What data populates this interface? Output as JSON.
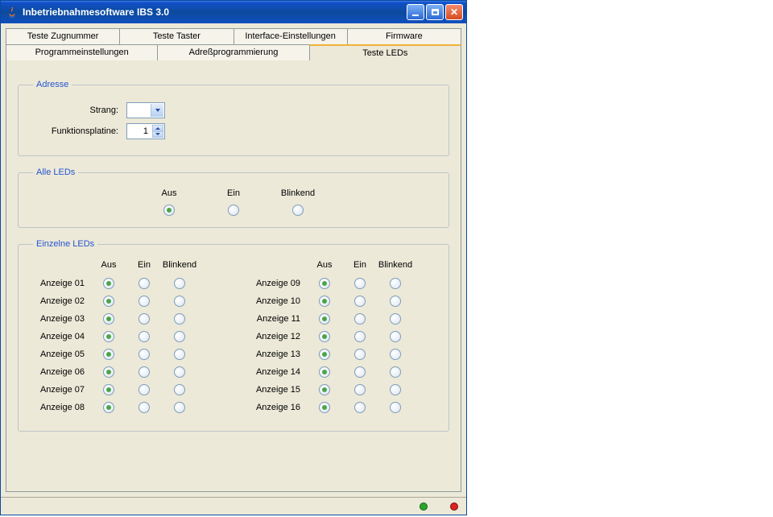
{
  "window": {
    "title": "Inbetriebnahmesoftware IBS 3.0"
  },
  "tabs_row1": [
    {
      "label": "Teste Zugnummer"
    },
    {
      "label": "Teste Taster"
    },
    {
      "label": "Interface-Einstellungen"
    },
    {
      "label": "Firmware"
    }
  ],
  "tabs_row2": [
    {
      "label": "Programmeinstellungen"
    },
    {
      "label": "Adreßprogrammierung"
    },
    {
      "label": "Teste LEDs"
    }
  ],
  "active_tab": "Teste LEDs",
  "groups": {
    "adresse": {
      "title": "Adresse",
      "strang_label": "Strang:",
      "strang_value": "",
      "funktionsplatine_label": "Funktionsplatine:",
      "funktionsplatine_value": "1"
    },
    "alle": {
      "title": "Alle LEDs",
      "headers": [
        "Aus",
        "Ein",
        "Blinkend"
      ],
      "selected": 0
    },
    "einzelne": {
      "title": "Einzelne LEDs",
      "headers": [
        "Aus",
        "Ein",
        "Blinkend"
      ],
      "left": [
        {
          "label": "Anzeige 01",
          "sel": 0
        },
        {
          "label": "Anzeige 02",
          "sel": 0
        },
        {
          "label": "Anzeige 03",
          "sel": 0
        },
        {
          "label": "Anzeige 04",
          "sel": 0
        },
        {
          "label": "Anzeige 05",
          "sel": 0
        },
        {
          "label": "Anzeige 06",
          "sel": 0
        },
        {
          "label": "Anzeige 07",
          "sel": 0
        },
        {
          "label": "Anzeige 08",
          "sel": 0
        }
      ],
      "right": [
        {
          "label": "Anzeige 09",
          "sel": 0
        },
        {
          "label": "Anzeige 10",
          "sel": 0
        },
        {
          "label": "Anzeige 11",
          "sel": 0
        },
        {
          "label": "Anzeige 12",
          "sel": 0
        },
        {
          "label": "Anzeige 13",
          "sel": 0
        },
        {
          "label": "Anzeige 14",
          "sel": 0
        },
        {
          "label": "Anzeige 15",
          "sel": 0
        },
        {
          "label": "Anzeige 16",
          "sel": 0
        }
      ]
    }
  },
  "status": {
    "dots": [
      "green",
      "red"
    ]
  }
}
